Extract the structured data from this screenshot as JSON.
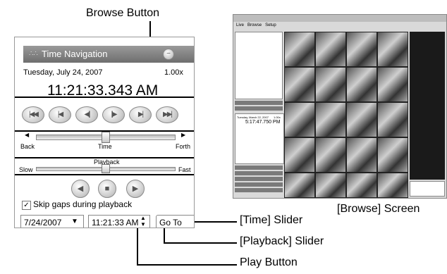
{
  "callouts": {
    "browse_button": "Browse Button",
    "browse_screen": "[Browse] Screen",
    "time_slider": "[Time] Slider",
    "playback_slider": "[Playback] Slider",
    "play_button": "Play Button"
  },
  "panel": {
    "title": "Time Navigation",
    "date": "Tuesday, July 24, 2007",
    "speed": "1.00x",
    "time": "11:21:33.343 AM",
    "time_slider": {
      "label_left": "Back",
      "label_center": "Time",
      "label_right": "Forth",
      "position": 0.5
    },
    "playback_slider": {
      "label_top": "Playback",
      "label_left": "Slow",
      "label_right": "Fast",
      "position": 0.5
    },
    "skip_gaps_label": "Skip gaps during playback",
    "skip_gaps_checked": true,
    "date_field": "7/24/2007",
    "time_field": "11:21:33 AM",
    "goto_button": "Go To"
  },
  "icons": {
    "nav": [
      "first-icon",
      "prev-icon",
      "step-back-icon",
      "step-forward-icon",
      "next-icon",
      "last-icon"
    ],
    "playback": [
      "reverse-icon",
      "stop-icon",
      "play-icon"
    ]
  },
  "browse_screen": {
    "toolbar": [
      "Live",
      "Browse",
      "Setup"
    ],
    "time": "5:17:47.750 PM",
    "date": "Tuesday, March 22, 2007",
    "speed": "1.00x"
  },
  "colors": {
    "title_bar": "#7a7a7a",
    "panel_border": "#999999"
  }
}
